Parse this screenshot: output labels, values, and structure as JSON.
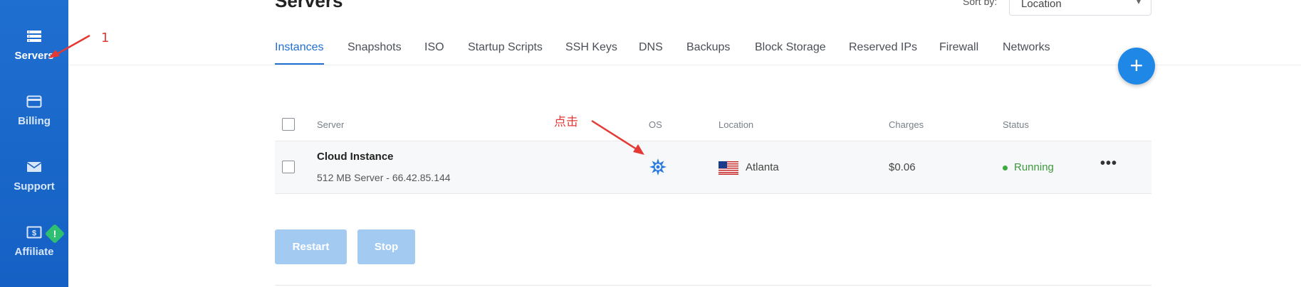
{
  "sidebar": {
    "items": [
      {
        "label": "Servers",
        "icon": "servers-icon",
        "active": true
      },
      {
        "label": "Billing",
        "icon": "credit-card-icon"
      },
      {
        "label": "Support",
        "icon": "envelope-icon"
      },
      {
        "label": "Affiliate",
        "icon": "dollar-bill-icon",
        "badge": "!"
      }
    ]
  },
  "header": {
    "title": "Servers",
    "sort_label": "Sort by:",
    "sort_value": "Location"
  },
  "tabs": [
    "Instances",
    "Snapshots",
    "ISO",
    "Startup Scripts",
    "SSH Keys",
    "DNS",
    "Backups",
    "Block Storage",
    "Reserved IPs",
    "Firewall",
    "Networks"
  ],
  "active_tab": "Instances",
  "fab_label": "+",
  "table": {
    "columns": [
      "Server",
      "OS",
      "Location",
      "Charges",
      "Status"
    ],
    "rows": [
      {
        "name": "Cloud Instance",
        "details": "512 MB Server - 66.42.85.144",
        "os_icon": "os-logo-icon",
        "location": "Atlanta",
        "flag": "us-flag-icon",
        "charges": "$0.06",
        "status": "Running",
        "actions": "•••"
      }
    ]
  },
  "buttons": {
    "restart": "Restart",
    "stop": "Stop"
  },
  "annotations": {
    "step_number": "1",
    "click_note": "点击"
  },
  "colors": {
    "sidebar": "#1560c4",
    "accent": "#1f6fd0",
    "fab": "#1f87e5",
    "running": "#3c9a3c",
    "annotation": "#e53935",
    "disabled_button": "#a3cbf1"
  }
}
